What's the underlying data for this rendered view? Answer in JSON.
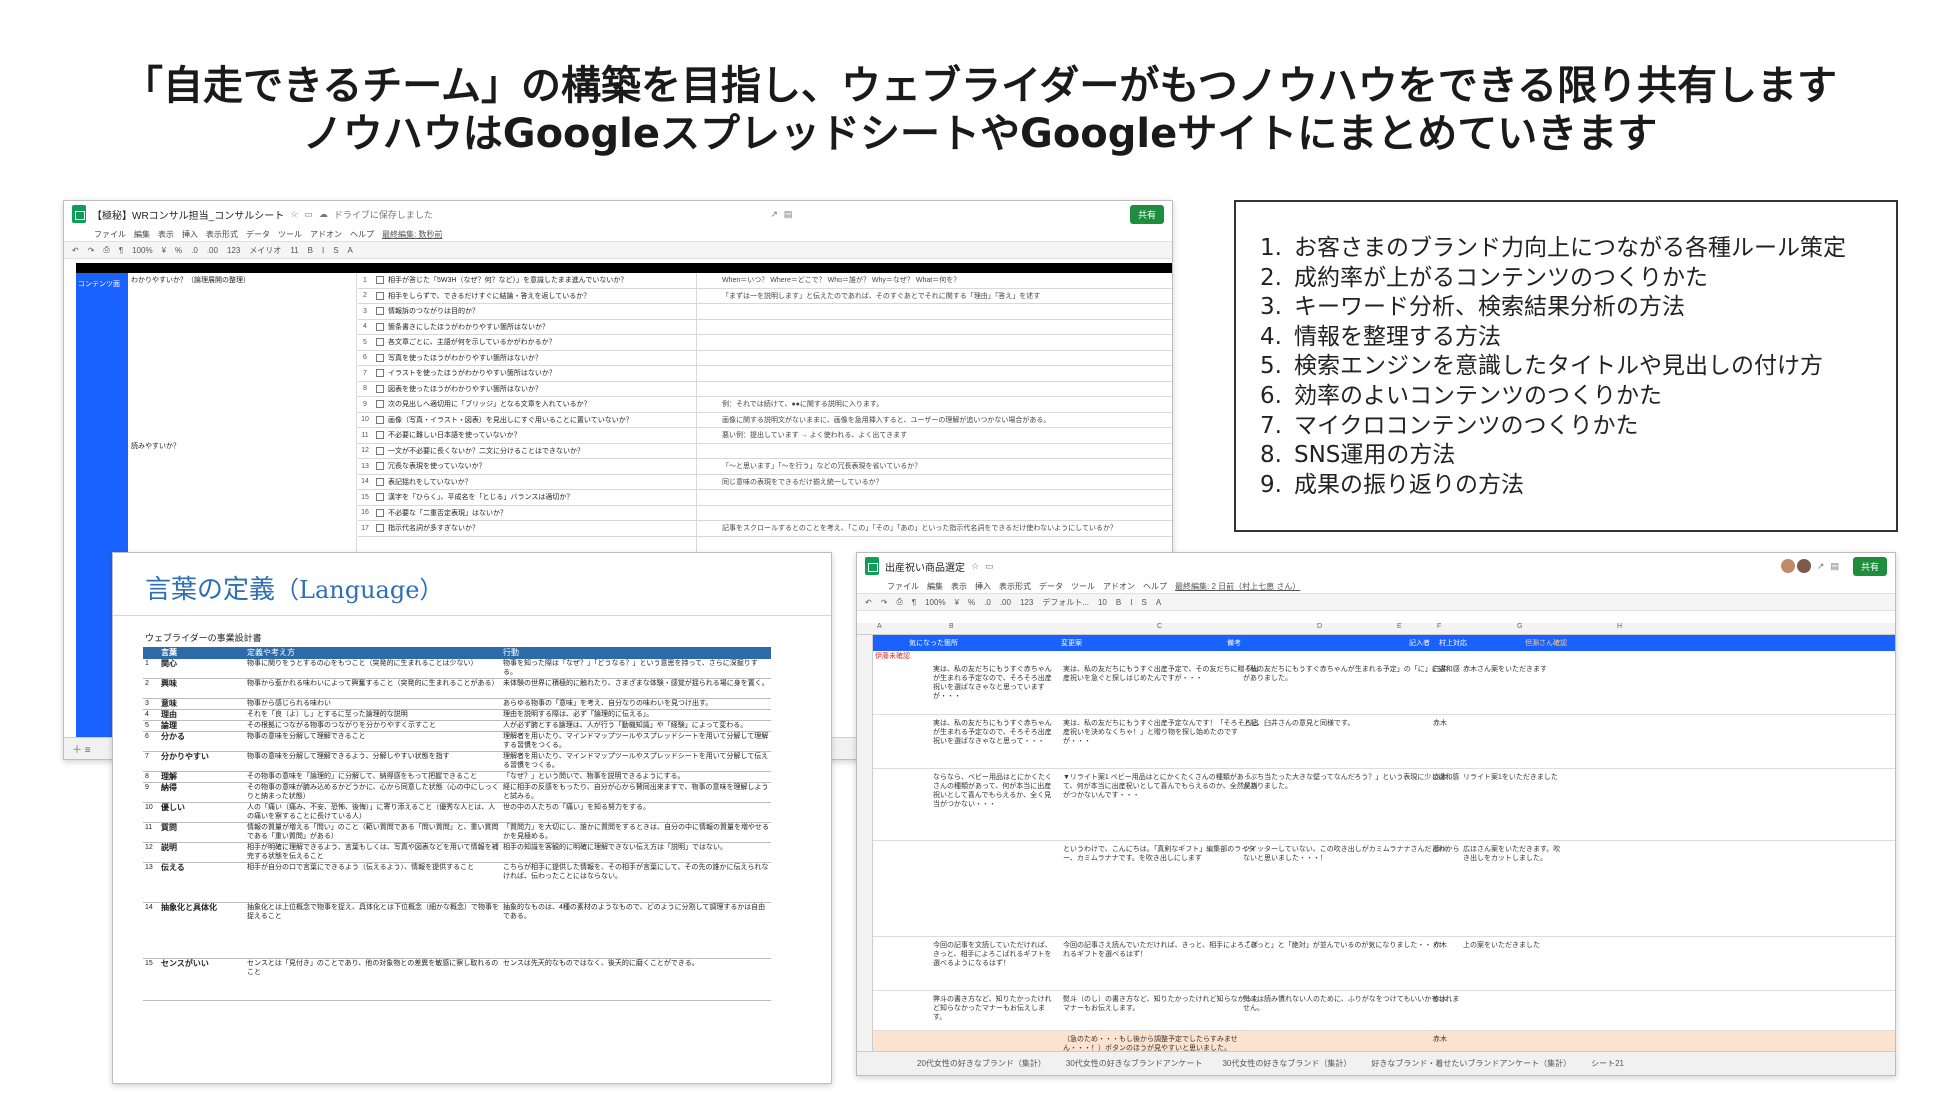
{
  "headline": {
    "line1": "「自走できるチーム」の構築を目指し、ウェブライダーがもつノウハウをできる限り共有します",
    "line2": "ノウハウはGoogleスプレッドシートやGoogleサイトにまとめていきます"
  },
  "list": {
    "items": [
      {
        "num": "1.",
        "text": "お客さまのブランド力向上につながる各種ルール策定"
      },
      {
        "num": "2.",
        "text": "成約率が上がるコンテンツのつくりかた"
      },
      {
        "num": "3.",
        "text": "キーワード分析、検索結果分析の方法"
      },
      {
        "num": "4.",
        "text": "情報を整理する方法"
      },
      {
        "num": "5.",
        "text": "検索エンジンを意識したタイトルや見出しの付け方"
      },
      {
        "num": "6.",
        "text": "効率のよいコンテンツのつくりかた"
      },
      {
        "num": "7.",
        "text": "マイクロコンテンツのつくりかた"
      },
      {
        "num": "8.",
        "text": "SNS運用の方法"
      },
      {
        "num": "9.",
        "text": "成果の振り返りの方法"
      }
    ]
  },
  "sheet1": {
    "title": "【極秘】WRコンサル担当_コンサルシート",
    "drive_note": "ドライブに保存しました",
    "share": "共有",
    "menu": [
      "ファイル",
      "編集",
      "表示",
      "挿入",
      "表示形式",
      "データ",
      "ツール",
      "アドオン",
      "ヘルプ"
    ],
    "last_edit": "最終編集: 数秒前",
    "toolbar": [
      "100%",
      "¥",
      "%",
      ".0",
      ".00",
      "123",
      "メイリオ",
      "11",
      "B",
      "I",
      "S",
      "A"
    ],
    "category1": "コンテンツ面",
    "sub1": "わかりやすいか？（論理展開の整理）",
    "sub2": "読みやすいか？",
    "rows": [
      {
        "n": "1",
        "q": "相手が答じた「5W3H（なぜ？何？など）」を意識したまま進んでいないか？",
        "note": "When＝いつ？ Where＝どこで？ Who＝誰が？ Why＝なぜ？ What＝何を？"
      },
      {
        "n": "2",
        "q": "相手をしらずで、できるだけすぐに結論・答えを返しているか？",
        "note": "「まずは一を説明します」と伝えたのであれば、そのすぐあとでそれに関する「理由」「答え」を述す"
      },
      {
        "n": "3",
        "q": "情報訴のつながりは目的か？",
        "note": ""
      },
      {
        "n": "4",
        "q": "箇条書きにしたほうがわかりやすい箇所はないか？",
        "note": ""
      },
      {
        "n": "5",
        "q": "各文章ごとに、主語が何を示しているかがわかるか？",
        "note": ""
      },
      {
        "n": "6",
        "q": "写真を使ったほうがわかりやすい箇所はないか？",
        "note": ""
      },
      {
        "n": "7",
        "q": "イラストを使ったほうがわかりやすい箇所はないか？",
        "note": ""
      },
      {
        "n": "8",
        "q": "図表を使ったほうがわかりやすい箇所はないか？",
        "note": ""
      },
      {
        "n": "9",
        "q": "次の見出しへ適切用に「ブリッジ」となる文章を入れているか？",
        "note": "例：それでは続けて、●●に関する説明に入ります。"
      },
      {
        "n": "10",
        "q": "画像（写真・イラスト・図表）を見出しにすぐ用いることに置いていないか？",
        "note": "画像に関する説明文がないままに、画像を急用挿入すると、ユーザーの理解が追いつかない場合がある。"
      },
      {
        "n": "11",
        "q": "不必要に難しい日本語を使っていないか？",
        "note": "悪い例：提出しています → よく使われる、よく出てきます"
      },
      {
        "n": "12",
        "q": "一文が不必要に長くないか？二文に分けることはできないか？",
        "note": ""
      },
      {
        "n": "13",
        "q": "冗長な表現を使っていないか？",
        "note": "「〜と思います」「〜を行う」などの冗長表現を省いているか？"
      },
      {
        "n": "14",
        "q": "表記揺れをしていないか？",
        "note": "同じ意味の表現をできるだけ揃え統一しているか？"
      },
      {
        "n": "15",
        "q": "漢字を「ひらく」、平成名を「とじる」バランスは適切か？",
        "note": ""
      },
      {
        "n": "16",
        "q": "不必要な「二重否定表現」はないか？",
        "note": ""
      },
      {
        "n": "17",
        "q": "指示代名詞が多すぎないか？",
        "note": "記事をスクロールするとのことを考え、「この」「その」「あの」といった指示代名詞をできるだけ使わないようにしているか？"
      }
    ]
  },
  "doc2": {
    "heading_ja": "言葉の定義",
    "heading_en": "（Language）",
    "table_title": "ウェブライダーの事業設計書",
    "headers": [
      "",
      "言葉",
      "定義や考え方",
      "行動"
    ],
    "rows": [
      {
        "n": "1",
        "word": "関心",
        "def": "物事に関りをうとするの心をもつこと（突発的に生まれることは少ない）",
        "act": "物事を知った際は「なぜ？」「どうなる？」という意思を持って、さらに深掘りする。"
      },
      {
        "n": "2",
        "word": "興味",
        "def": "物事から惹かれる味わいによって興奮すること（突発的に生まれることがある）",
        "act": "未体験の世界に積極的に触れたり、さまざまな体験・感覚が揺られる場に身を置く。"
      },
      {
        "n": "3",
        "word": "意味",
        "def": "物事から感じられる味わい",
        "act": "あらゆる物事の「意味」を考え、自分なりの味わいを見つけ出す。"
      },
      {
        "n": "4",
        "word": "理由",
        "def": "それを「良（よ）し」とするに至った論理的な説明",
        "act": "理由を説明する際は、必ず「論理的に伝える」。"
      },
      {
        "n": "5",
        "word": "論理",
        "def": "その根拠につながる物事のつながりを分かりやすく示すこと",
        "act": "人が必ず腑とする論理は、人が行う「動機知識」や「経験」によって変わる。"
      },
      {
        "n": "6",
        "word": "分かる",
        "def": "物事の意味を分解して理解できること",
        "act": "理解者を用いたり、マインドマップツールやスプレッドシートを用いて分解して理解する習慣をつくる。"
      },
      {
        "n": "7",
        "word": "分かりやすい",
        "def": "物事の意味を分解して理解できるよう、分解しやすい状態を指す",
        "act": "理解者を用いたり、マインドマップツールやスプレッドシートを用いて分解して伝える習慣をつくる。"
      },
      {
        "n": "8",
        "word": "理解",
        "def": "その物事の意味を「論理的」に分解して、納得感をもって把握できること",
        "act": "「なぜ？」という問いで、物事を説明できるようにする。"
      },
      {
        "n": "9",
        "word": "納得",
        "def": "その物事の意味が腑み込めるかどうかに、心から同意した状態（心の中にしっくりと納まった状態）",
        "act": "経に相手の反感をもったり、自分が心から賛同出来ますで、物事の意味を理解しようと試みる。"
      },
      {
        "n": "10",
        "word": "優しい",
        "def": "人の「痛い（痛み、不安、恐怖、後悔）」に寄り添えること（優秀な人とは、人の痛いを察することに長けている人）",
        "act": "世の中の人たちの「痛い」を知る努力をする。"
      },
      {
        "n": "11",
        "word": "質問",
        "def": "情報の質量が増える「問い」のこと（範い質問である「問い質問」と、重い質問である「重い質問」がある）",
        "act": "「質問力」を大切にし、誰かに質問をするときは、自分の中に情報の質量を増やせるかを見極める。"
      },
      {
        "n": "12",
        "word": "説明",
        "def": "相手が明確に理解できるよう、言葉もしくは、写真や図表などを用いて情報を補完する状態を伝えること",
        "act": "相手の知識を客観的に明確に理解できない伝え方は「説明」ではない。"
      },
      {
        "n": "13",
        "word": "伝える",
        "def": "相手が自分の口で言葉にできるよう（伝えるよう）、情報を提供すること",
        "act": "こちらが相手に提供した情報を、その相手が言葉にして、その先の誰かに伝えられなければ、伝わったことにはならない。"
      },
      {
        "n": "14",
        "word": "抽象化と具体化",
        "def": "抽象化とは上位概念で物事を捉え、具体化とは下位概念（細かな概念）で物事を捉えること",
        "act": "抽象的なものは、4種の素材のようなもので、どのように分割して調理するかは自由である。"
      },
      {
        "n": "15",
        "word": "センスがいい",
        "def": "センスとは「見付き」のことであり、他の対象物との差異を敏感に察し取れるのこと",
        "act": "センスは先天的なものではなく、後天的に磨くことができる。"
      }
    ]
  },
  "sheet3": {
    "title": "出産祝い商品選定",
    "share": "共有",
    "menu": [
      "ファイル",
      "編集",
      "表示",
      "挿入",
      "表示形式",
      "データ",
      "ツール",
      "アドオン",
      "ヘルプ"
    ],
    "last_edit": "最終編集: 2 日前（村上七恵 さん）",
    "toolbar": [
      "100%",
      "¥",
      "%",
      ".0",
      ".00",
      "123",
      "デフォルト...",
      "10",
      "B",
      "I",
      "S",
      "A"
    ],
    "columns": [
      "A",
      "B",
      "C",
      "D",
      "E",
      "F",
      "G",
      "H"
    ],
    "header_cells": [
      "気になった箇所",
      "変更案",
      "備考",
      "記入者",
      "村上対応",
      "但淵さん確認"
    ],
    "status": "伊藤未確認",
    "rows": [
      {
        "a": "実は、私の友だちにもうすぐ赤ちゃんが生まれる予定なので、そろそろ出産祝いを選ばなきゃなと思っていますが・・・",
        "b": "実は、私の友だちにもうすぐ出産予定で、その友だちに贈る出産祝いを急ぐと探しはじめたんですが・・・",
        "c": "「私の友だちにもうすぐ赤ちゃんが生まれる予定」の「に」に違和感がありました。",
        "d": "臼井",
        "e": "赤木さん案をいただきます",
        "h": 54
      },
      {
        "a": "実は、私の友だちにもうすぐ赤ちゃんが生まれる予定なので、そろそろ出産祝いを選ばなきゃなと思って・・・",
        "b": "実は、私の友だちにもうすぐ出産予定なんです！「そろそろ出産祝いを決めなくちゃ！」と贈り物を探し始めたのですが・・・",
        "c": "上記、臼井さんの意見と同様です。",
        "d": "赤木",
        "e": "",
        "h": 54
      },
      {
        "a": "ならなら、ベビー用品はとにかくたくさんの種類があって、何が本当に出産祝いとして喜んでもらえるか、全く見当がつかない・・・",
        "b": "▼リライト案1 ベビー用品はとにかくたくさんの種類があって、何が本当に出産祝いとして喜んでもらえるのか、全然見当がつかないんです・・・",
        "c": "「ぶち当たった大きな壁ってなんだろう？」という表現に少し違和感がありました。",
        "d": "赤木",
        "e": "リライト案1をいただきました",
        "h": 72
      },
      {
        "a": "",
        "b": "というわけで、こんにちは。「真剣なギフト」編集部のライター、カミムラナナです。を吹き出しにします",
        "c": "ツイッターしていない、この吹き出しがカミムラナナさんだとわからないと思いました・・・！",
        "d": "藤川",
        "e": "広ほさん案をいただきます。吹き出しをカットしました。",
        "h": 96
      },
      {
        "a": "今回の記事を文読していただければ、きっと、相手によろこばれるギフトを選べるようになるはず！",
        "b": "今回の記事さえ読んでいただければ、きっと、相手によろこばれるギフトを選べるはず！",
        "c": "「きっと」と「絶対」が並んでいるのが気になりました・・・！",
        "d": "赤木",
        "e": "上の案をいただきました",
        "h": 54
      },
      {
        "a": "弊斗の書き方など、知りたかったけれど知らなかったマナーもお伝えします。",
        "b": "熨斗（のし）の書き方など、知りたかったけれど知らなかったマナーもお伝えします。",
        "c": "熨斗は読み慣れない人のために、ふりがなをつけてもいいかもしれません。",
        "d": "赤木",
        "e": "",
        "h": 40
      },
      {
        "a": "",
        "b": "（急のため・・・もし後から調整予定でしたらすみません・・・！）ボタンのほうが見やすいと思いました。",
        "c": "",
        "d": "赤木",
        "e": "",
        "h": 40,
        "peach": true
      }
    ],
    "tabs": [
      "20代女性の好きなブランド（集計）",
      "30代女性の好きなブランドアンケート",
      "30代女性の好きなブランド（集計）",
      "好きなブランド・着せたいブランドアンケート（集計）",
      "シート21"
    ]
  }
}
